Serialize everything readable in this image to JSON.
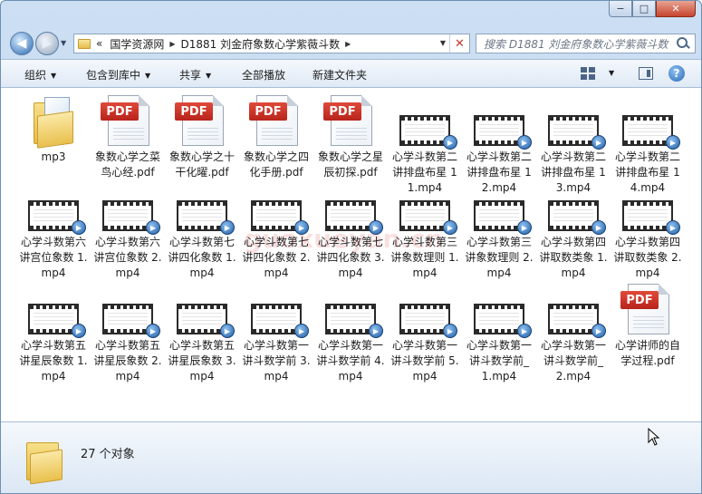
{
  "window": {
    "minimize_glyph": "−",
    "maximize_glyph": "□",
    "close_glyph": "✕"
  },
  "navigation": {
    "back_glyph": "◀",
    "forward_glyph": "▶",
    "breadcrumb": {
      "prefix": "«",
      "items": [
        "国学资源网",
        "D1881 刘金府象数心学紫薇斗数"
      ]
    },
    "refresh_glyph": "✕",
    "search_placeholder": "搜索 D1881 刘金府象数心学紫薇斗数"
  },
  "toolbar": {
    "organize": "组织",
    "include_in_library": "包含到库中",
    "share": "共享",
    "play_all": "全部播放",
    "new_folder": "新建文件夹",
    "help": "?"
  },
  "watermark": "guoxueyan.cn",
  "files": [
    {
      "name": "mp3",
      "type": "folder"
    },
    {
      "name": "象数心学之菜鸟心经.pdf",
      "type": "pdf"
    },
    {
      "name": "象数心学之十干化曜.pdf",
      "type": "pdf"
    },
    {
      "name": "象数心学之四化手册.pdf",
      "type": "pdf"
    },
    {
      "name": "象数心学之星辰初探.pdf",
      "type": "pdf"
    },
    {
      "name": "心学斗数第二讲排盘布星 1 1.mp4",
      "type": "video"
    },
    {
      "name": "心学斗数第二讲排盘布星 1 2.mp4",
      "type": "video"
    },
    {
      "name": "心学斗数第二讲排盘布星 1 3.mp4",
      "type": "video"
    },
    {
      "name": "心学斗数第二讲排盘布星 1 4.mp4",
      "type": "video"
    },
    {
      "name": "心学斗数第六讲宫位象数 1.mp4",
      "type": "video"
    },
    {
      "name": "心学斗数第六讲宫位象数 2.mp4",
      "type": "video"
    },
    {
      "name": "心学斗数第七讲四化象数 1.mp4",
      "type": "video"
    },
    {
      "name": "心学斗数第七讲四化象数 2.mp4",
      "type": "video"
    },
    {
      "name": "心学斗数第七讲四化象数 3.mp4",
      "type": "video"
    },
    {
      "name": "心学斗数第三讲象数理则 1.mp4",
      "type": "video"
    },
    {
      "name": "心学斗数第三讲象数理则 2.mp4",
      "type": "video"
    },
    {
      "name": "心学斗数第四讲取数类象 1.mp4",
      "type": "video"
    },
    {
      "name": "心学斗数第四讲取数类象 2.mp4",
      "type": "video"
    },
    {
      "name": "心学斗数第五讲星辰象数 1.mp4",
      "type": "video"
    },
    {
      "name": "心学斗数第五讲星辰象数 2.mp4",
      "type": "video"
    },
    {
      "name": "心学斗数第五讲星辰象数 3.mp4",
      "type": "video"
    },
    {
      "name": "心学斗数第一讲斗数学前 3.mp4",
      "type": "video"
    },
    {
      "name": "心学斗数第一讲斗数学前 4.mp4",
      "type": "video"
    },
    {
      "name": "心学斗数第一讲斗数学前 5.mp4",
      "type": "video"
    },
    {
      "name": "心学斗数第一讲斗数学前_1.mp4",
      "type": "video"
    },
    {
      "name": "心学斗数第一讲斗数学前_2.mp4",
      "type": "video"
    },
    {
      "name": "心学讲师的自学过程.pdf",
      "type": "pdf"
    }
  ],
  "pdf_tag": "PDF",
  "status": {
    "item_count": "27 个对象"
  }
}
